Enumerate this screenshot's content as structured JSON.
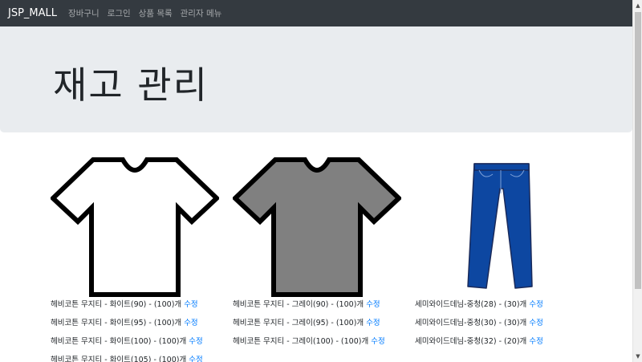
{
  "navbar": {
    "brand": "JSP_MALL",
    "links": [
      "장바구니",
      "로그인",
      "상품 목록",
      "관리자 메뉴"
    ]
  },
  "page": {
    "title": "재고 관리"
  },
  "products": [
    {
      "image": "white-tshirt",
      "stock": [
        {
          "text": "헤비코튼 무지티 - 화이트(90) - (100)개",
          "edit": "수정"
        },
        {
          "text": "헤비코튼 무지티 - 화이트(95) - (100)개",
          "edit": "수정"
        },
        {
          "text": "헤비코튼 무지티 - 화이트(100) - (100)개",
          "edit": "수정"
        },
        {
          "text": "헤비코튼 무지티 - 화이트(105) - (100)개",
          "edit": "수정"
        }
      ]
    },
    {
      "image": "gray-tshirt",
      "stock": [
        {
          "text": "헤비코튼 무지티 - 그레이(90) - (100)개",
          "edit": "수정"
        },
        {
          "text": "헤비코튼 무지티 - 그레이(95) - (100)개",
          "edit": "수정"
        },
        {
          "text": "헤비코튼 무지티 - 그레이(100) - (100)개",
          "edit": "수정"
        }
      ]
    },
    {
      "image": "blue-jeans",
      "stock": [
        {
          "text": "세미와이드데님-중청(28) - (30)개",
          "edit": "수정"
        },
        {
          "text": "세미와이드데님-중청(30) - (30)개",
          "edit": "수정"
        },
        {
          "text": "세미와이드데님-중청(32) - (20)개",
          "edit": "수정"
        }
      ]
    }
  ],
  "colors": {
    "navbar_bg": "#343a40",
    "jumbotron_bg": "#e9ecef",
    "link": "#007bff",
    "shirt_white": "#ffffff",
    "shirt_gray": "#808080",
    "jeans_blue": "#0d47a1"
  }
}
